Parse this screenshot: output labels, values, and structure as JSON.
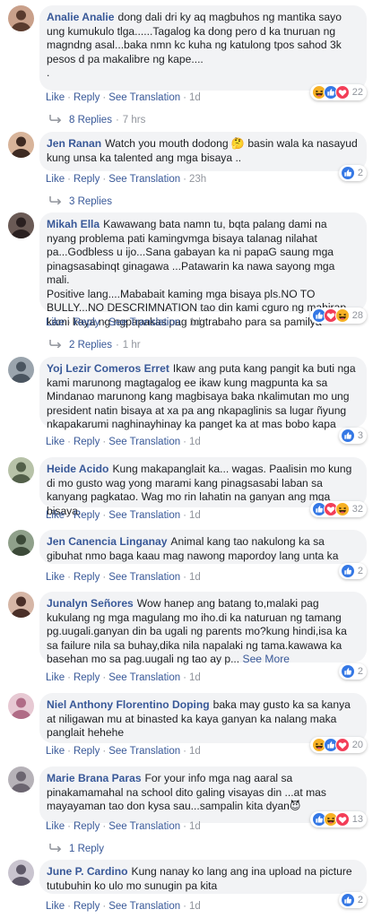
{
  "ui": {
    "like_label": "Like",
    "reply_label": "Reply",
    "translate_label": "See Translation",
    "separator": "·",
    "see_more_label": "See More"
  },
  "colors": {
    "link_blue": "#385898",
    "bubble_gray": "#f2f3f5",
    "meta_gray": "#90949c",
    "like_blue": "#3578e5",
    "love_red": "#f33e58",
    "haha_yellow": "#f7b125"
  },
  "comments": [
    {
      "author": "Analie Analie",
      "text": "dong dali dri ky aq magbuhos ng mantika sayo ung kumukulo tlga......Tagalog ka dong pero d ka tnuruan ng magndng asal...baka nmn kc kuha ng katulong tpos sahod 3k pesos d pa makalibre ng kape....\n.",
      "see_more": "",
      "time": "1d",
      "reactions": [
        "haha",
        "like",
        "love"
      ],
      "reaction_count": "22",
      "replies_label": "8 Replies",
      "replies_time": "7 hrs"
    },
    {
      "author": "Jen Ranan",
      "text": "Watch you mouth dodong 🤔 basin wala ka nasayud kung unsa ka talented ang mga bisaya ..",
      "see_more": "",
      "time": "23h",
      "reactions": [
        "like"
      ],
      "reaction_count": "2",
      "replies_label": "3 Replies",
      "replies_time": ""
    },
    {
      "author": "Mikah Ella",
      "text": "Kawawang bata namn tu, bqta palang dami na nyang problema pati kamingvmga bisaya talanag nilahat pa...Godbless u ijo...Sana gabayan ka ni papaG saung mga pinagsasabinqt ginagawa ...Patawarin ka nawa sayong mga mali.\nPositive lang....Mababait kaming mga bisaya pls.NO TO BULLY...NO DESCRIMNATION tao din kami cguro ng mahirap kami kaya ng ngpapakasipag mgtrabaho para sa pamilya",
      "see_more": "",
      "time": "1d",
      "reactions": [
        "like",
        "love",
        "haha"
      ],
      "reaction_count": "28",
      "replies_label": "2 Replies",
      "replies_time": "1 hr"
    },
    {
      "author": "Yoj Lezir Comeros Erret",
      "text": "Ikaw ang puta kang pangit ka buti nga kami marunong magtagalog ee ikaw kung magpunta ka sa Mindanao marunong kang magbisaya baka nkalimutan mo ung president natin bisaya at xa pa ang nkapaglinis sa lugar ñyung nkapakarumi naghinayhinay ka panget ka at mas bobo kapa",
      "see_more": "",
      "time": "1d",
      "reactions": [
        "like"
      ],
      "reaction_count": "3",
      "replies_label": "",
      "replies_time": ""
    },
    {
      "author": "Heide Acido",
      "text": "Kung makapanglait ka... wagas. Paalisin mo kung di mo gusto wag yong marami kang pinagsasabi laban sa kanyang pagkatao. Wag mo rin lahatin na ganyan ang mga bisaya.",
      "see_more": "",
      "time": "1d",
      "reactions": [
        "like",
        "love",
        "haha"
      ],
      "reaction_count": "32",
      "replies_label": "",
      "replies_time": ""
    },
    {
      "author": "Jen Canencia Linganay",
      "text": "Animal kang tao nakulong ka sa gibuhat nmo baga kaau mag nawong mapordoy lang unta ka",
      "see_more": "",
      "time": "1d",
      "reactions": [
        "like"
      ],
      "reaction_count": "2",
      "replies_label": "",
      "replies_time": ""
    },
    {
      "author": "Junalyn Señores",
      "text": "Wow hanep ang batang to,malaki pag kukulang ng mga magulang mo iho.di ka naturuan ng tamang pg.uugali.ganyan din ba ugali ng parents mo?kung hindi,isa ka sa failure nila sa buhay,dika nila napalaki ng tama.kawawa ka basehan mo sa pag.uugali ng tao ay p... ",
      "see_more": "See More",
      "time": "1d",
      "reactions": [
        "like"
      ],
      "reaction_count": "2",
      "replies_label": "",
      "replies_time": ""
    },
    {
      "author": "Niel Anthony Florentino Doping",
      "text": "baka may gusto ka sa kanya at niligawan mu at binasted ka kaya ganyan ka nalang maka panglait hehehe",
      "see_more": "",
      "time": "1d",
      "reactions": [
        "haha",
        "like",
        "love"
      ],
      "reaction_count": "20",
      "replies_label": "",
      "replies_time": ""
    },
    {
      "author": "Marie Brana Paras",
      "text": "For your info mga nag aaral sa pinakamamahal na school dito galing visayas din ...at mas mayayaman tao don kysa sau...sampalin kita dyan😈",
      "see_more": "",
      "time": "1d",
      "reactions": [
        "like",
        "haha",
        "love"
      ],
      "reaction_count": "13",
      "replies_label": "1 Reply",
      "replies_time": ""
    },
    {
      "author": "June P. Cardino",
      "text": "Kung nanay ko lang ang ina upload na picture tutubuhin ko ulo mo sunugin pa kita",
      "see_more": "",
      "time": "1d",
      "reactions": [
        "like"
      ],
      "reaction_count": "2",
      "replies_label": "",
      "replies_time": ""
    }
  ]
}
